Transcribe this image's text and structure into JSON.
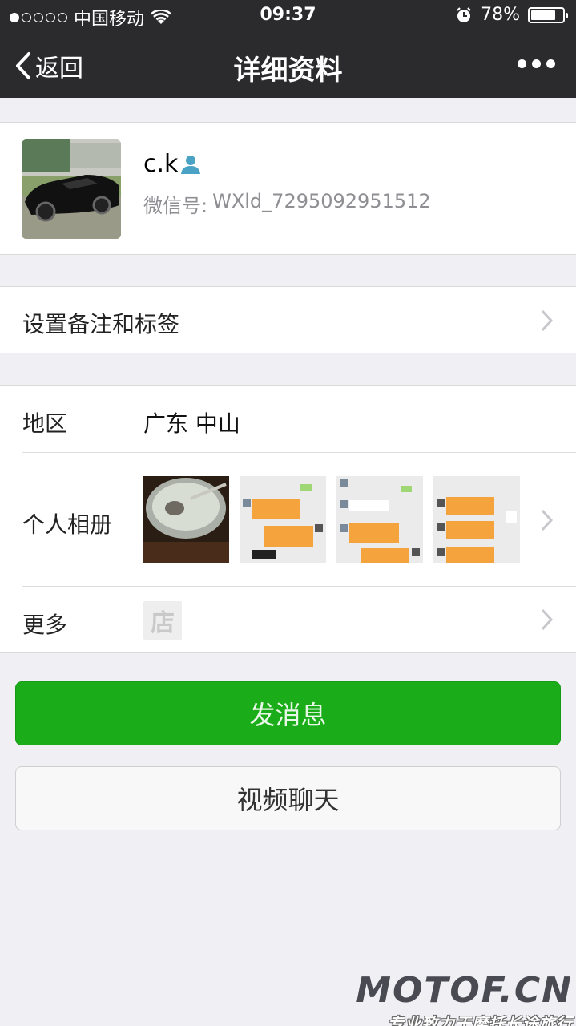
{
  "status_bar": {
    "carrier": "中国移动",
    "time": "09:37",
    "battery_percent": "78%",
    "battery_level": 0.78,
    "signal_bars_filled": 1,
    "signal_bars_total": 5,
    "icons": [
      "wifi-icon",
      "alarm-icon",
      "battery-icon"
    ]
  },
  "navbar": {
    "back_label": "返回",
    "title": "详细资料",
    "more_icon": "more-dots-icon"
  },
  "profile": {
    "name": "c.k",
    "name_badge_icon": "person-badge-icon",
    "wechat_id_label": "微信号:",
    "wechat_id_value": "WXld_7295092951512"
  },
  "remark": {
    "label": "设置备注和标签"
  },
  "info": {
    "region_label": "地区",
    "region_value": "广东 中山",
    "album_label": "个人相册",
    "album_thumbnails": [
      "photo-bowl",
      "screenshot-chat-1",
      "screenshot-chat-2",
      "screenshot-chat-3"
    ],
    "more_label": "更多",
    "shop_icon_text": "店"
  },
  "buttons": {
    "send_message": "发消息",
    "video_chat": "视频聊天"
  },
  "colors": {
    "nav_bg": "#2b2b2e",
    "page_bg": "#efeff4",
    "primary_green": "#1aad19"
  },
  "watermark": {
    "main": "MOTOF.CN",
    "sub": "专业致力于摩托长途旅行"
  }
}
